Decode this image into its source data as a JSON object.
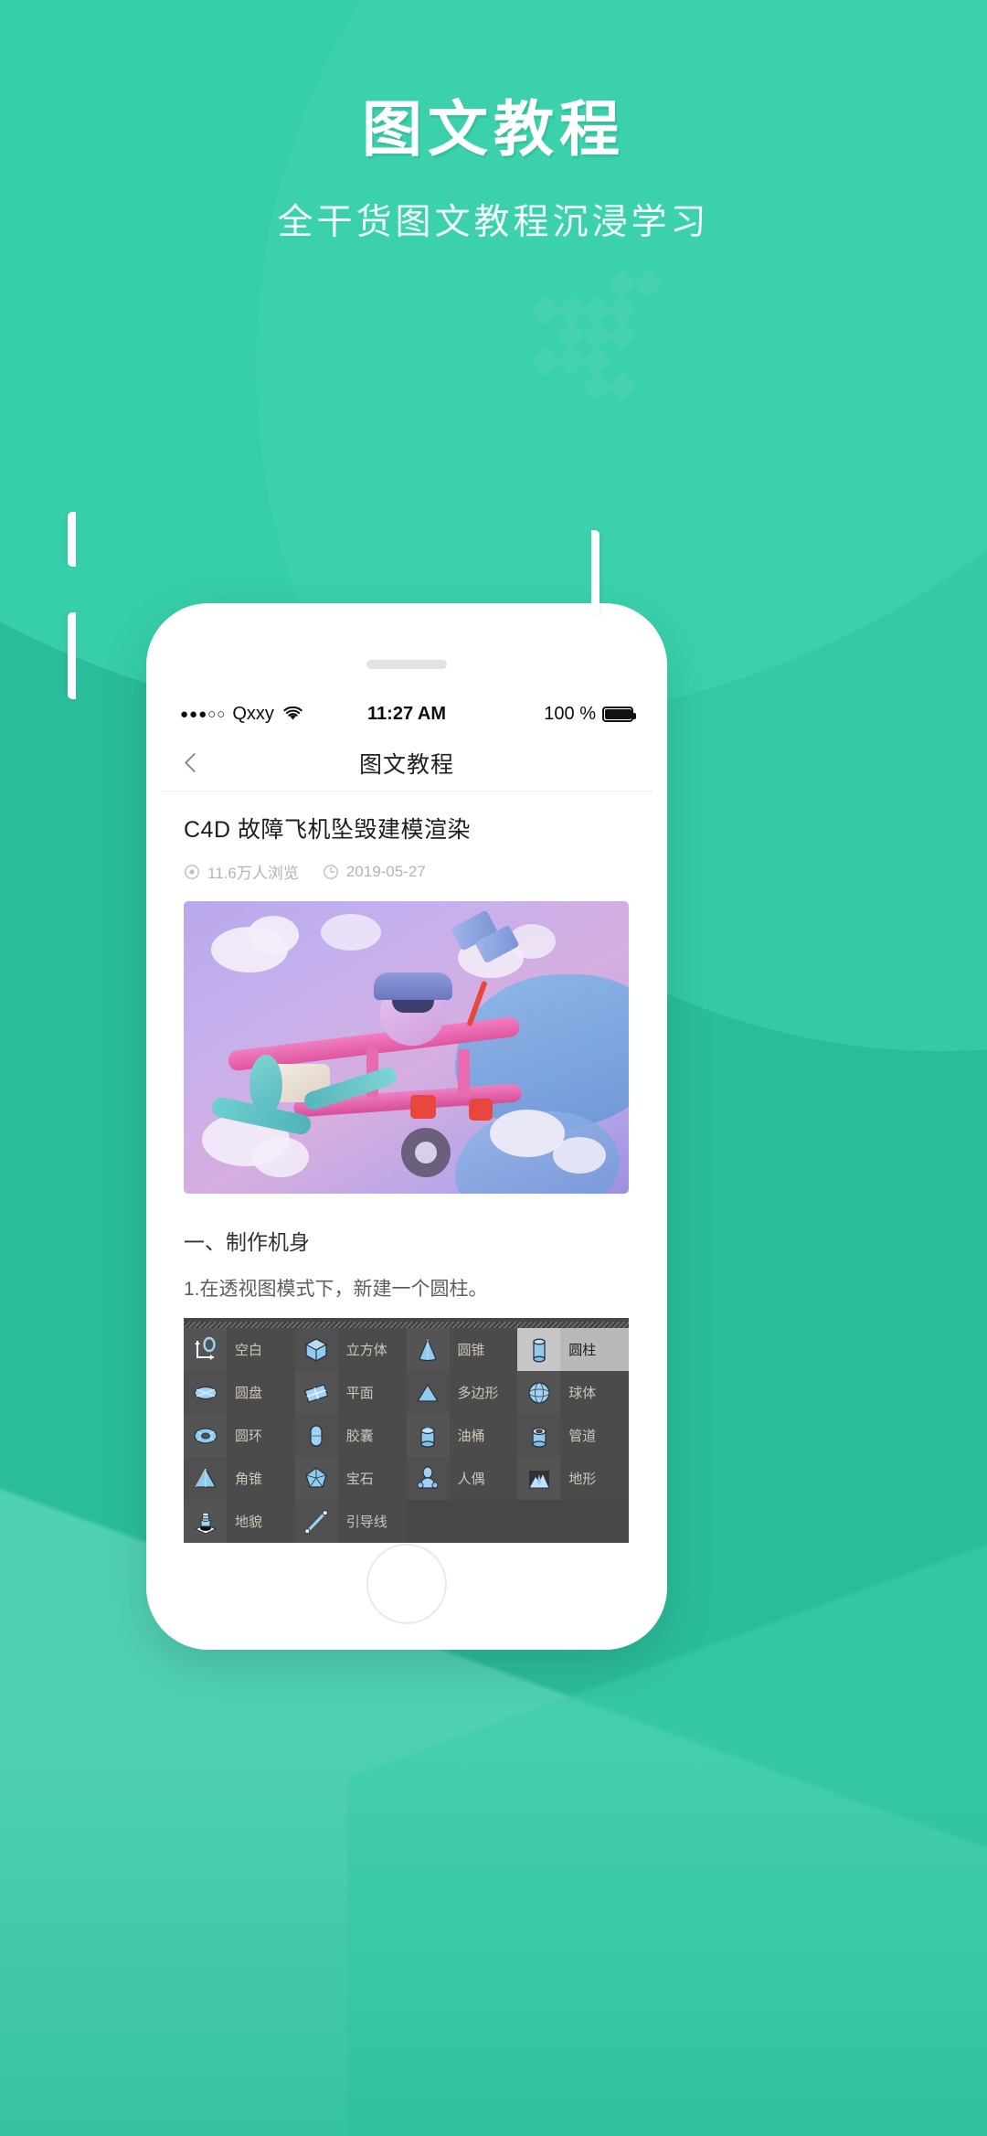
{
  "header": {
    "title": "图文教程",
    "subtitle": "全干货图文教程沉浸学习"
  },
  "colors": {
    "brand_green": "#2bbd9b",
    "brand_green_light": "#3ed3ae",
    "panel_dark": "#474747",
    "panel_label": "#cfc6b8",
    "selected_bg": "#b9b9b9"
  },
  "phone": {
    "status_bar": {
      "signal_dots": "●●●○○",
      "carrier": "Qxxy",
      "wifi_icon": "wifi-icon",
      "time": "11:27 AM",
      "battery_percent": "100 %",
      "battery_icon": "battery-full-icon"
    },
    "nav_bar": {
      "back_icon": "chevron-left-icon",
      "title": "图文教程"
    },
    "article": {
      "title": "C4D 故障飞机坠毁建模渲染",
      "meta": {
        "views_icon": "eye-icon",
        "views": "11.6万人浏览",
        "date_icon": "clock-icon",
        "date": "2019-05-27"
      },
      "hero_image_alt": "3d-pink-airplane-illustration",
      "section_heading": "一、制作机身",
      "body_text": "1.在透视图模式下，新建一个圆柱。"
    },
    "c4d_panel": {
      "rows": [
        [
          {
            "icon": "null-object-icon",
            "label": "空白",
            "selected": false
          },
          {
            "icon": "cube-icon",
            "label": "立方体",
            "selected": false
          },
          {
            "icon": "cone-icon",
            "label": "圆锥",
            "selected": false
          },
          {
            "icon": "cylinder-icon",
            "label": "圆柱",
            "selected": true
          }
        ],
        [
          {
            "icon": "disc-icon",
            "label": "圆盘",
            "selected": false
          },
          {
            "icon": "plane-icon",
            "label": "平面",
            "selected": false
          },
          {
            "icon": "polygon-icon",
            "label": "多边形",
            "selected": false
          },
          {
            "icon": "sphere-icon",
            "label": "球体",
            "selected": false
          }
        ],
        [
          {
            "icon": "torus-icon",
            "label": "圆环",
            "selected": false
          },
          {
            "icon": "capsule-icon",
            "label": "胶囊",
            "selected": false
          },
          {
            "icon": "oil-tank-icon",
            "label": "油桶",
            "selected": false
          },
          {
            "icon": "tube-icon",
            "label": "管道",
            "selected": false
          }
        ],
        [
          {
            "icon": "pyramid-icon",
            "label": "角锥",
            "selected": false
          },
          {
            "icon": "platonic-icon",
            "label": "宝石",
            "selected": false
          },
          {
            "icon": "figure-icon",
            "label": "人偶",
            "selected": false
          },
          {
            "icon": "landscape-icon",
            "label": "地形",
            "selected": false
          }
        ],
        [
          {
            "icon": "relief-icon",
            "label": "地貌",
            "selected": false
          },
          {
            "icon": "guide-line-icon",
            "label": "引导线",
            "selected": false
          },
          {
            "icon": "",
            "label": "",
            "selected": false
          },
          {
            "icon": "",
            "label": "",
            "selected": false
          }
        ]
      ]
    }
  }
}
